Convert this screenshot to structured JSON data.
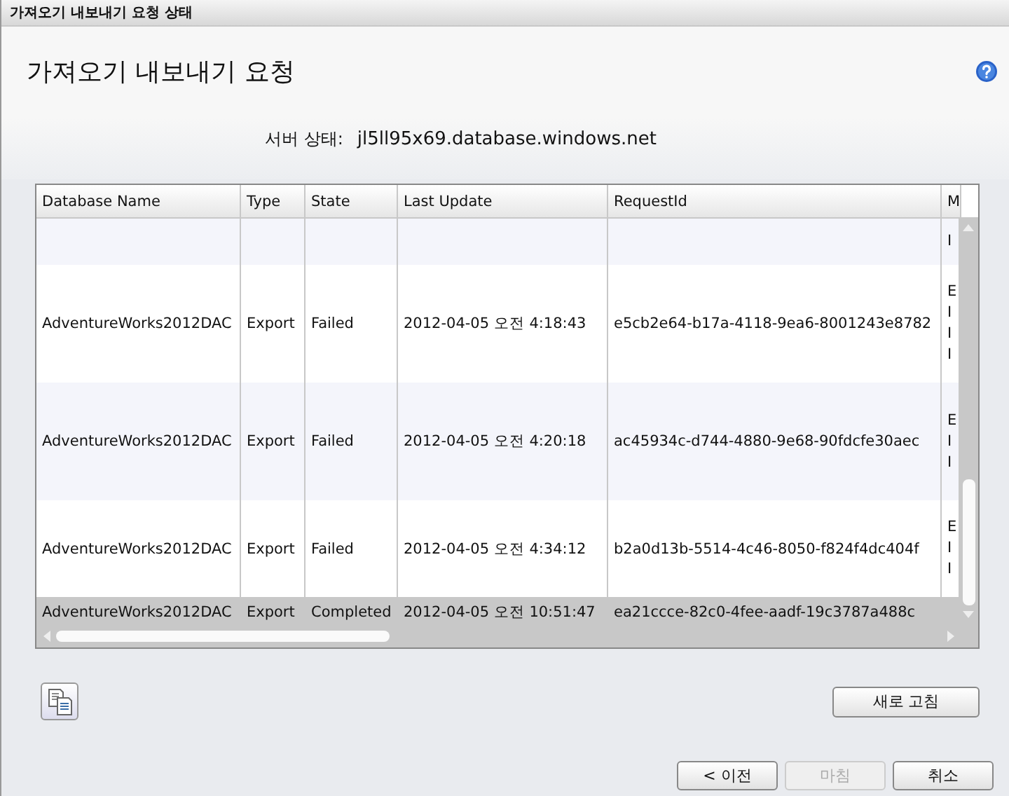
{
  "window": {
    "title": "가져오기 내보내기 요청 상태"
  },
  "heading": "가져오기 내보내기 요청",
  "server": {
    "label": "서버 상태:",
    "value": "jl5ll95x69.database.windows.net"
  },
  "table": {
    "columns": [
      "Database Name",
      "Type",
      "State",
      "Last Update",
      "RequestId",
      "M"
    ],
    "rows": [
      {
        "selected": false,
        "cells": [
          "",
          "",
          "",
          "",
          "",
          [
            "I"
          ]
        ]
      },
      {
        "selected": false,
        "cells": [
          "AdventureWorks2012DAC",
          "Export",
          "Failed",
          "2012-04-05 오전 4:18:43",
          "e5cb2e64-b17a-4118-9ea6-8001243e8782",
          [
            "E",
            "I",
            "I",
            "I"
          ]
        ]
      },
      {
        "selected": false,
        "cells": [
          "AdventureWorks2012DAC",
          "Export",
          "Failed",
          "2012-04-05 오전 4:20:18",
          "ac45934c-d744-4880-9e68-90fdcfe30aec",
          [
            "E",
            "I",
            "I"
          ]
        ]
      },
      {
        "selected": false,
        "cells": [
          "AdventureWorks2012DAC",
          "Export",
          "Failed",
          "2012-04-05 오전 4:34:12",
          "b2a0d13b-5514-4c46-8050-f824f4dc404f",
          [
            "E",
            "I",
            "I"
          ]
        ]
      },
      {
        "selected": true,
        "cells": [
          "AdventureWorks2012DAC",
          "Export",
          "Completed",
          "2012-04-05 오전 10:51:47",
          "ea21ccce-82c0-4fee-aadf-19c3787a488c",
          []
        ]
      }
    ]
  },
  "refresh_button": {
    "label": "새로 고침"
  },
  "buttons": [
    {
      "label": "< 이전",
      "disabled": false
    },
    {
      "label": "마침",
      "disabled": true
    },
    {
      "label": "취소",
      "disabled": false
    }
  ]
}
